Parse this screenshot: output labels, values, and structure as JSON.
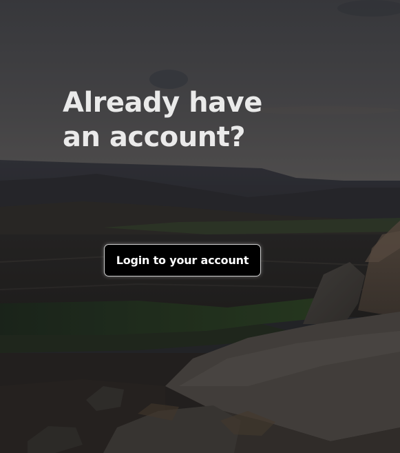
{
  "hero": {
    "heading_line1": "Already have",
    "heading_line2": "an account?",
    "login_button_label": "Login to your account",
    "background": "moorland-landscape-photo"
  },
  "colors": {
    "heading_text": "#eaeaea",
    "button_background": "#000000",
    "button_text": "#ffffff",
    "button_border": "#cfcfcf"
  }
}
